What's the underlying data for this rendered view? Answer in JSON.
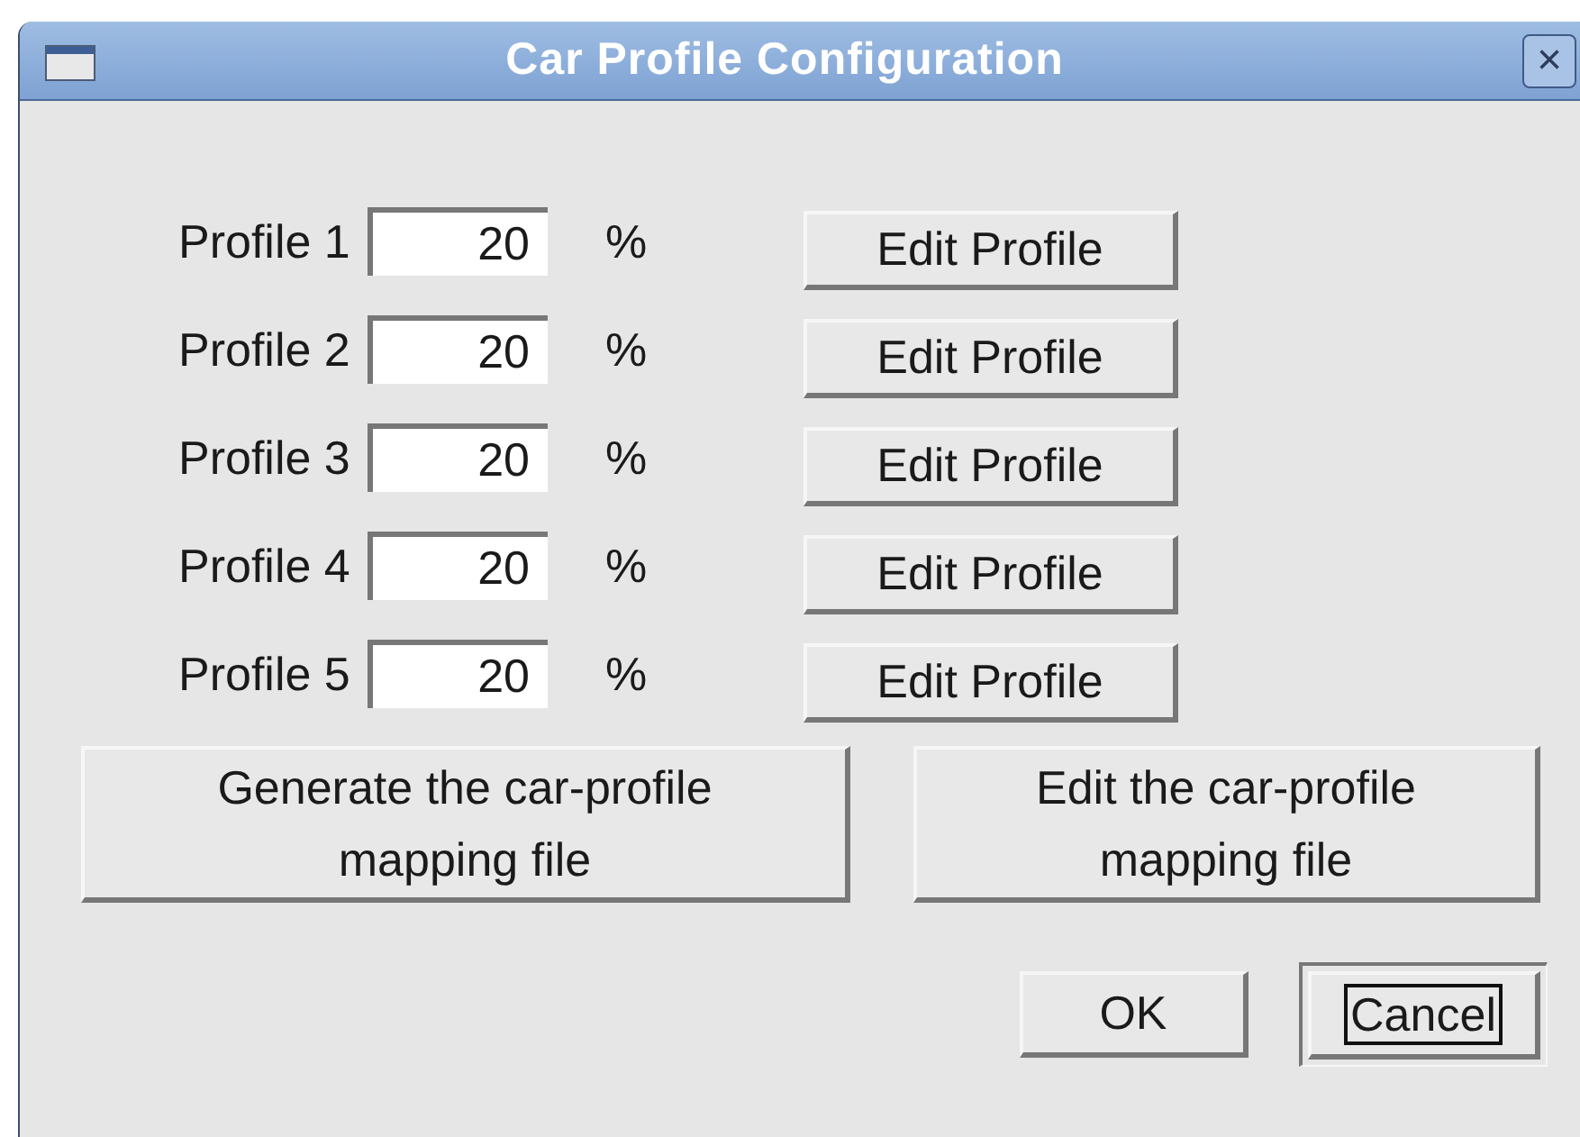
{
  "window": {
    "title": "Car Profile Configuration",
    "close_glyph": "×"
  },
  "profiles": [
    {
      "label": "Profile 1",
      "value": "20",
      "unit": "%",
      "button": "Edit Profile"
    },
    {
      "label": "Profile 2",
      "value": "20",
      "unit": "%",
      "button": "Edit Profile"
    },
    {
      "label": "Profile 3",
      "value": "20",
      "unit": "%",
      "button": "Edit Profile"
    },
    {
      "label": "Profile 4",
      "value": "20",
      "unit": "%",
      "button": "Edit Profile"
    },
    {
      "label": "Profile 5",
      "value": "20",
      "unit": "%",
      "button": "Edit Profile"
    }
  ],
  "mapping_buttons": [
    {
      "label": "Generate the car-profile mapping file"
    },
    {
      "label": "Edit the car-profile mapping file"
    }
  ],
  "dialog_buttons": [
    {
      "label": "OK",
      "default": false
    },
    {
      "label": "Cancel",
      "default": true
    }
  ]
}
